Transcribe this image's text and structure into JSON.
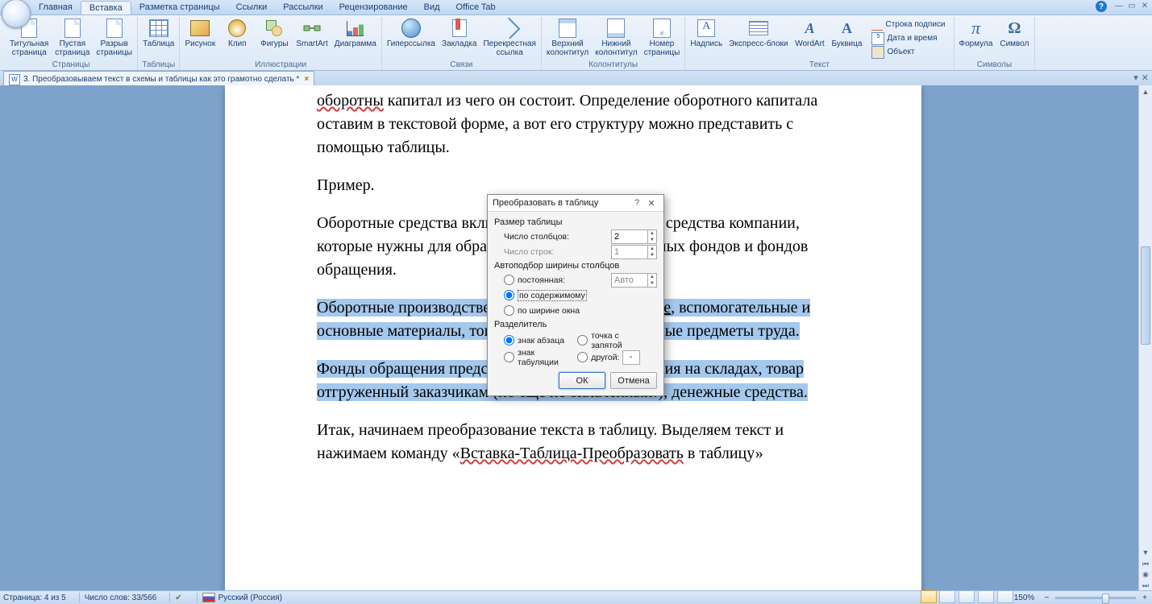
{
  "menu": {
    "tabs": [
      "Главная",
      "Вставка",
      "Разметка страницы",
      "Ссылки",
      "Рассылки",
      "Рецензирование",
      "Вид",
      "Office Tab"
    ],
    "active_index": 1
  },
  "ribbon": {
    "groups": [
      {
        "label": "Страницы",
        "items": [
          {
            "label": "Титульная\nстраница",
            "icon": "page"
          },
          {
            "label": "Пустая\nстраница",
            "icon": "page"
          },
          {
            "label": "Разрыв\nстраницы",
            "icon": "page"
          }
        ]
      },
      {
        "label": "Таблицы",
        "items": [
          {
            "label": "Таблица",
            "icon": "table"
          }
        ]
      },
      {
        "label": "Иллюстрации",
        "items": [
          {
            "label": "Рисунок",
            "icon": "pic"
          },
          {
            "label": "Клип",
            "icon": "clip"
          },
          {
            "label": "Фигуры",
            "icon": "shapes"
          },
          {
            "label": "SmartArt",
            "icon": "smart"
          },
          {
            "label": "Диаграмма",
            "icon": "chart"
          }
        ]
      },
      {
        "label": "Связи",
        "items": [
          {
            "label": "Гиперссылка",
            "icon": "link"
          },
          {
            "label": "Закладка",
            "icon": "bookmark"
          },
          {
            "label": "Перекрестная\nссылка",
            "icon": "arrow"
          }
        ]
      },
      {
        "label": "Колонтитулы",
        "items": [
          {
            "label": "Верхний\nколонтитул",
            "icon": "header"
          },
          {
            "label": "Нижний\nколонтитул",
            "icon": "footer"
          },
          {
            "label": "Номер\nстраницы",
            "icon": "pageno"
          }
        ]
      },
      {
        "label": "Текст",
        "items": [
          {
            "label": "Надпись",
            "icon": "textbox"
          },
          {
            "label": "Экспресс-блоки",
            "icon": "express"
          },
          {
            "label": "WordArt",
            "icon": "wordart"
          },
          {
            "label": "Буквица",
            "icon": "dropcap"
          }
        ],
        "small": [
          {
            "label": "Строка подписи",
            "icon": "sig"
          },
          {
            "label": "Дата и время",
            "icon": "date"
          },
          {
            "label": "Объект",
            "icon": "obj"
          }
        ]
      },
      {
        "label": "Символы",
        "items": [
          {
            "label": "Формула",
            "icon": "formula"
          },
          {
            "label": "Символ",
            "icon": "symbol"
          }
        ]
      }
    ]
  },
  "tabstrip": {
    "doc_title": "3. Преобразовываем текст в схемы и таблицы как это грамотно сделать *"
  },
  "document": {
    "p1_a": "оборотны",
    "p1_b": " капитал  из чего он состоит. Определение оборотного капитала оставим в текстовой форме, а вот его структуру можно представить с помощью таблицы.",
    "p2": "Пример.",
    "p3": "Оборотные средства включают производственные средства компании, которые нужны для образования и производственных фондов и фондов обращения.",
    "p4_a": "Оборотные производственные фонды — это: ",
    "p4_link": "сырье",
    "p4_b": ", вспомогательные и основные материалы, топливо, тара, запчасти и иные предметы труда.",
    "p5": "Фонды обращения представляют: готовая продукция на складах, товар отгруженный заказчикам (но еще не оплаченный!), денежные средства.",
    "p6_a": "Итак, начинаем преобразование текста в таблицу. Выделяем текст и нажимаем команду «",
    "p6_link": "Вставка-Таблица-Преобразовать",
    "p6_b": " в таблицу»"
  },
  "dialog": {
    "title": "Преобразовать в таблицу",
    "sec_size": "Размер таблицы",
    "cols_label": "Число столбцов:",
    "cols_value": "2",
    "rows_label": "Число строк:",
    "rows_value": "1",
    "sec_autofit": "Автоподбор ширины столбцов",
    "opt_fixed": "постоянная:",
    "fixed_value": "Авто",
    "opt_content": "по содержимому",
    "opt_window": "по ширине окна",
    "sec_sep": "Разделитель",
    "sep_para": "знак абзаца",
    "sep_semi": "точка с запятой",
    "sep_tab": "знак табуляции",
    "sep_other": "другой:",
    "other_value": "-",
    "ok": "ОК",
    "cancel": "Отмена"
  },
  "status": {
    "page": "Страница: 4 из 5",
    "words": "Число слов: 33/566",
    "lang": "Русский (Россия)",
    "zoom": "150%"
  }
}
